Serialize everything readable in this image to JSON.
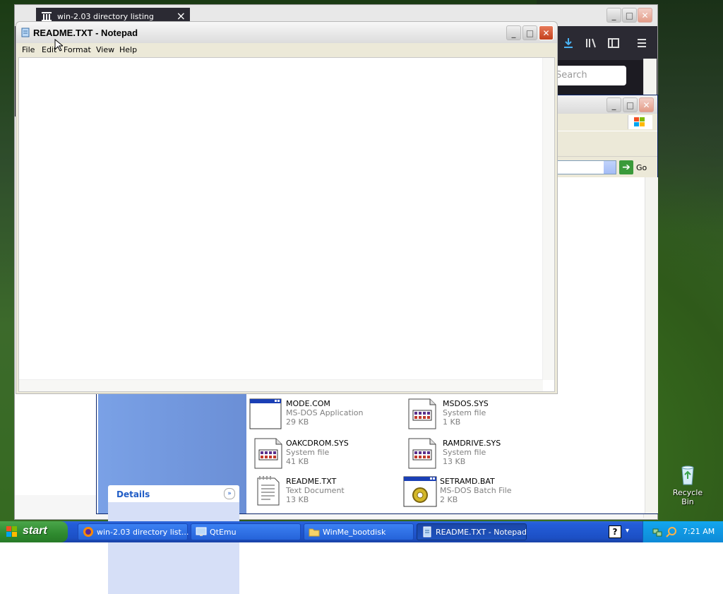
{
  "browser": {
    "tab_title": "win-2.03 directory listing",
    "search_placeholder": "Search"
  },
  "explorer": {
    "go_label": "Go",
    "details_label": "Details",
    "files": [
      {
        "name": "MODE.COM",
        "type": "MS-DOS Application",
        "size": "29 KB",
        "icon": "dos-app-icon"
      },
      {
        "name": "MSDOS.SYS",
        "type": "System file",
        "size": "1 KB",
        "icon": "system-file-icon"
      },
      {
        "name": "OAKCDROM.SYS",
        "type": "System file",
        "size": "41 KB",
        "icon": "system-file-icon"
      },
      {
        "name": "RAMDRIVE.SYS",
        "type": "System file",
        "size": "13 KB",
        "icon": "system-file-icon"
      },
      {
        "name": "README.TXT",
        "type": "Text Document",
        "size": "13 KB",
        "icon": "text-document-icon"
      },
      {
        "name": "SETRAMD.BAT",
        "type": "MS-DOS Batch File",
        "size": "2 KB",
        "icon": "batch-file-icon"
      }
    ]
  },
  "notepad": {
    "title": "README.TXT - Notepad",
    "menu": [
      "File",
      "Edit",
      "Format",
      "View",
      "Help"
    ],
    "content": ""
  },
  "desktop": {
    "recycle_bin_label": "Recycle Bin"
  },
  "taskbar": {
    "start_label": "start",
    "tasks": [
      {
        "label": "win-2.03 directory list...",
        "active": false
      },
      {
        "label": "QtEmu",
        "active": false
      },
      {
        "label": "WinMe_bootdisk",
        "active": false
      },
      {
        "label": "README.TXT - Notepad",
        "active": true
      }
    ],
    "clock": "7:21 AM"
  }
}
